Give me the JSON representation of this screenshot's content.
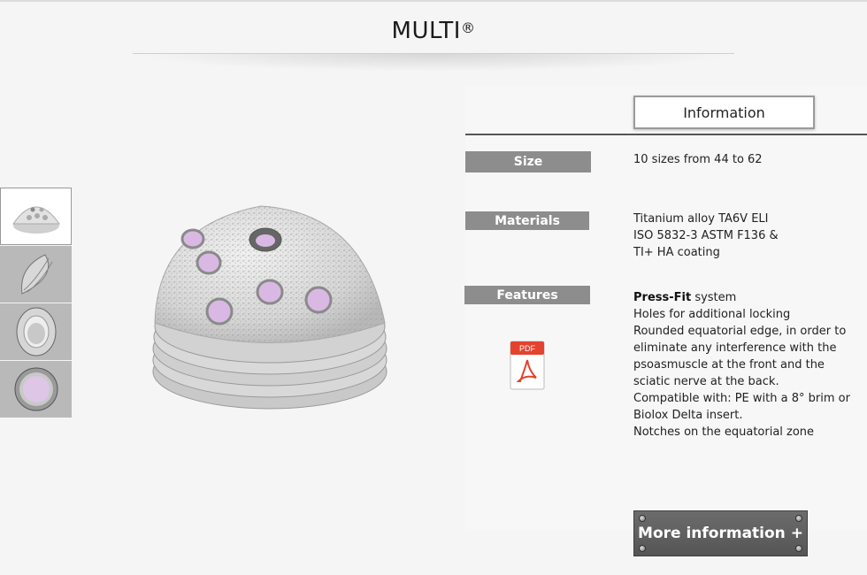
{
  "page": {
    "title": "MULTI",
    "title_mark": "®"
  },
  "thumbnails": [
    {
      "icon": "cup-top-view-icon",
      "active": true
    },
    {
      "icon": "cup-side-view-icon",
      "active": false
    },
    {
      "icon": "cup-angled-view-icon",
      "active": false
    },
    {
      "icon": "cup-inner-view-icon",
      "active": false
    }
  ],
  "main_image": {
    "icon": "acetabular-cup-image"
  },
  "tabs": {
    "information": "Information"
  },
  "specs": {
    "size": {
      "label": "Size",
      "value": "10 sizes from 44 to 62"
    },
    "materials": {
      "label": "Materials",
      "lines": [
        "Titanium alloy TA6V ELI",
        "ISO 5832-3 ASTM F136 &",
        "TI+ HA coating"
      ]
    },
    "features": {
      "label": "Features",
      "lead": "Press-Fit",
      "lead_rest": " system",
      "lines": [
        "Holes for additional locking",
        "Rounded equatorial edge, in order to",
        "eliminate any interference with the",
        "psoasmuscle at the front and the",
        "sciatic nerve at the back.",
        "Compatible with: PE with a 8° brim or",
        "Biolox Delta insert.",
        "Notches on the equatorial zone"
      ]
    }
  },
  "pdf": {
    "label": "PDF",
    "icon": "pdf-icon"
  },
  "more_button": {
    "label": "More information +"
  },
  "colors": {
    "label_bg": "#8d8d8d",
    "button_bg": "#5f5f5f",
    "pdf_red": "#e4432d",
    "hole_purple": "#d9b9e3"
  }
}
